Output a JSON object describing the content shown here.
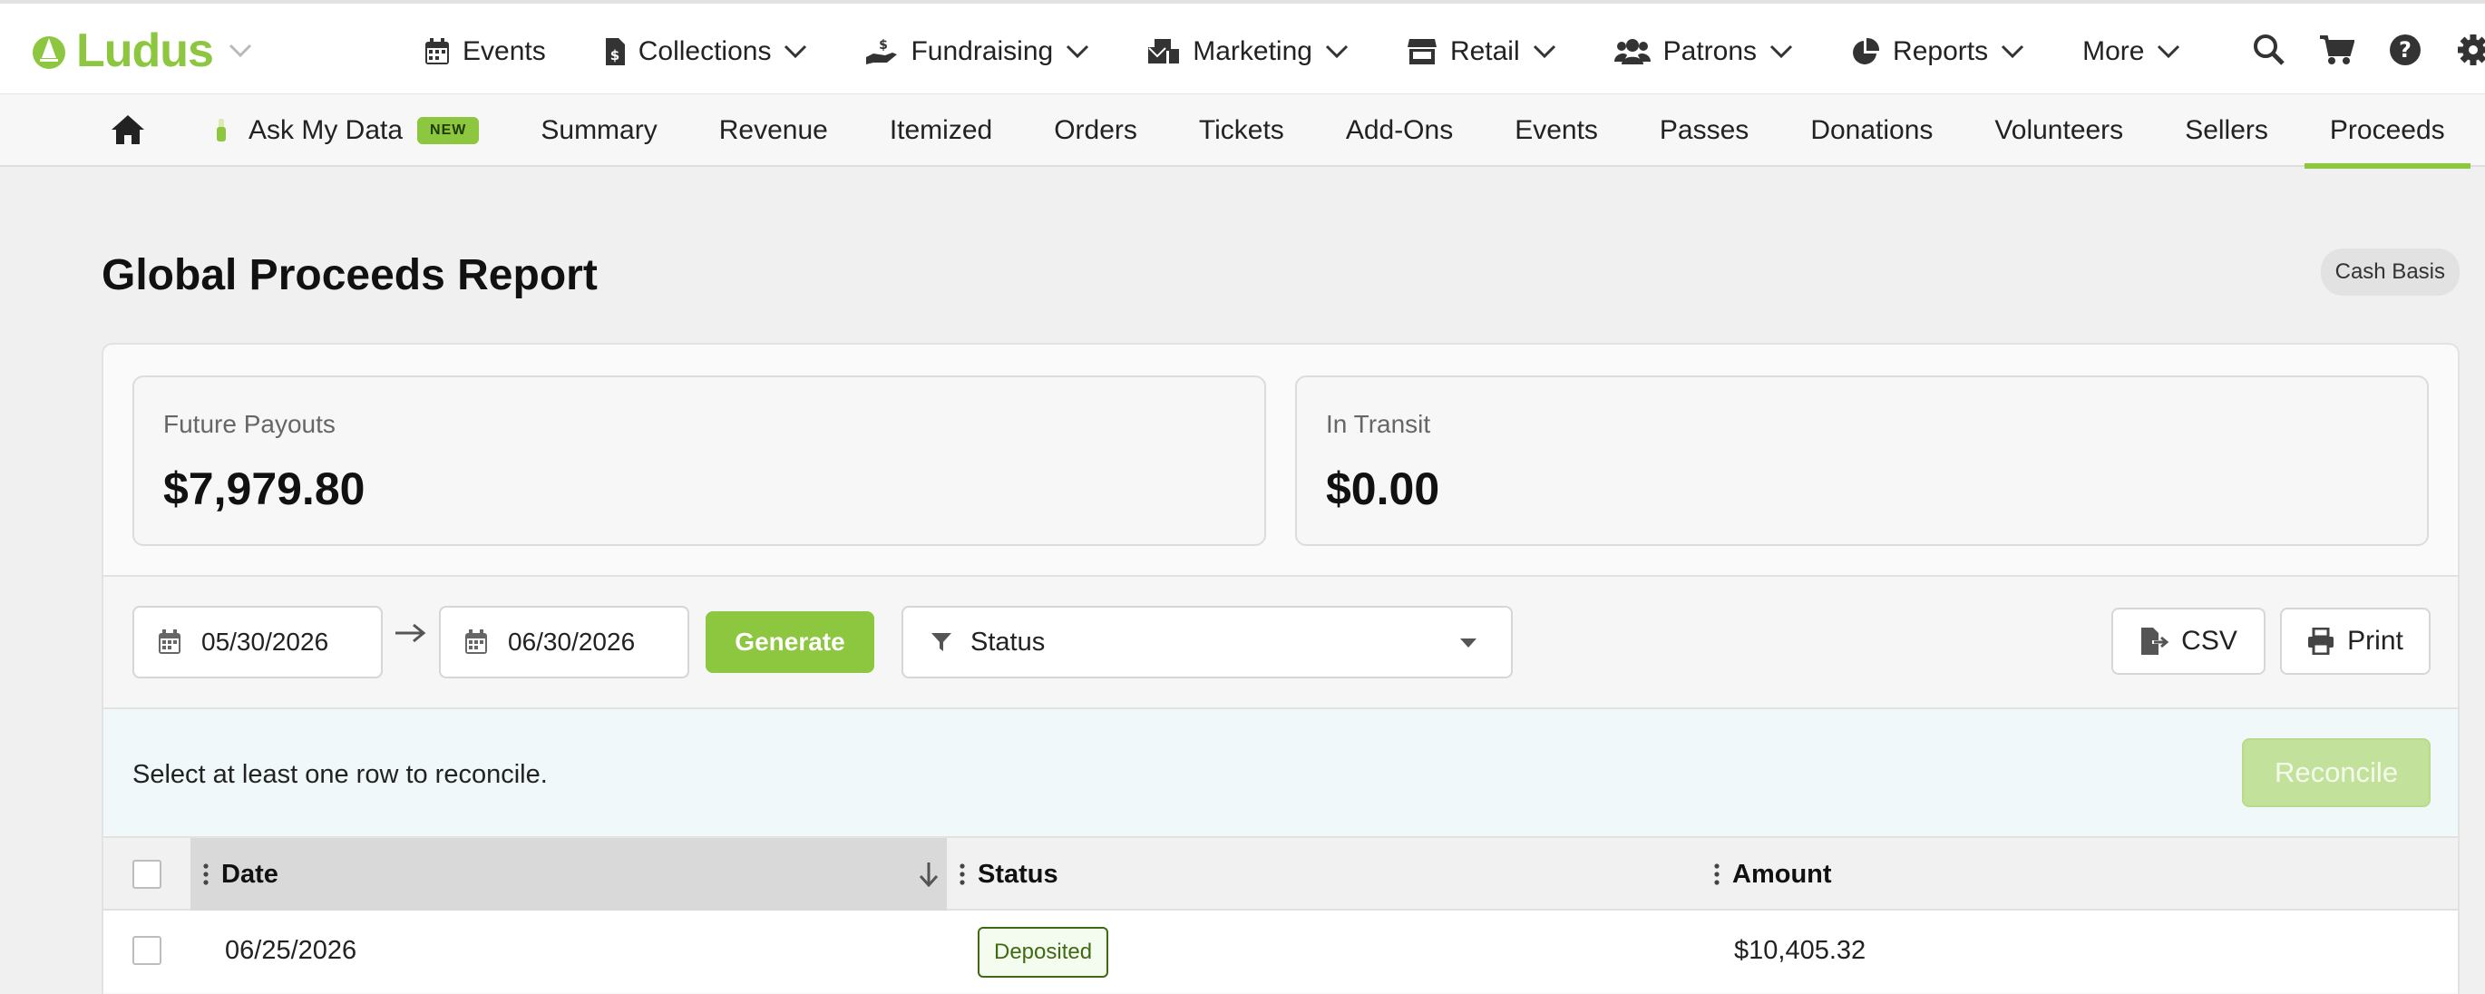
{
  "brand": {
    "name": "Ludus",
    "accent": "#8dc63f"
  },
  "main_nav": [
    {
      "label": "Events",
      "icon": "calendar-icon",
      "has_caret": false
    },
    {
      "label": "Collections",
      "icon": "invoice-dollar-icon",
      "has_caret": true
    },
    {
      "label": "Fundraising",
      "icon": "hand-holding-dollar-icon",
      "has_caret": true
    },
    {
      "label": "Marketing",
      "icon": "mail-bulk-icon",
      "has_caret": true
    },
    {
      "label": "Retail",
      "icon": "store-icon",
      "has_caret": true
    },
    {
      "label": "Patrons",
      "icon": "users-icon",
      "has_caret": true
    },
    {
      "label": "Reports",
      "icon": "pie-chart-icon",
      "has_caret": true
    },
    {
      "label": "More",
      "icon": "",
      "has_caret": true
    }
  ],
  "top_icons": [
    "search-icon",
    "cart-icon",
    "help-icon",
    "gear-icon"
  ],
  "sub_nav": {
    "home_icon": "home-icon",
    "ask_my_data": {
      "label": "Ask My Data",
      "badge": "NEW"
    },
    "tabs": [
      "Summary",
      "Revenue",
      "Itemized",
      "Orders",
      "Tickets",
      "Add-Ons",
      "Events",
      "Passes",
      "Donations",
      "Volunteers",
      "Sellers",
      "Proceeds"
    ],
    "active_tab": "Proceeds"
  },
  "page": {
    "title": "Global Proceeds Report",
    "basis_badge": "Cash Basis"
  },
  "stats": {
    "future_payouts": {
      "label": "Future Payouts",
      "value": "$7,979.80"
    },
    "in_transit": {
      "label": "In Transit",
      "value": "$0.00"
    }
  },
  "filters": {
    "date_from": "05/30/2026",
    "date_to": "06/30/2026",
    "generate_label": "Generate",
    "status_placeholder": "Status",
    "csv_label": "CSV",
    "print_label": "Print"
  },
  "reconcile": {
    "message": "Select at least one row to reconcile.",
    "button_label": "Reconcile"
  },
  "table": {
    "columns": {
      "date": "Date",
      "status": "Status",
      "amount": "Amount"
    },
    "sort": {
      "column": "Date",
      "direction": "desc"
    },
    "rows": [
      {
        "date": "06/25/2026",
        "status": "Deposited",
        "amount": "$10,405.32"
      }
    ]
  }
}
